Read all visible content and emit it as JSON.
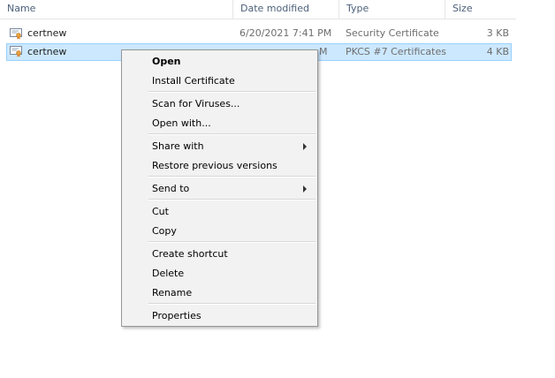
{
  "columns": {
    "name": "Name",
    "date_modified": "Date modified",
    "type": "Type",
    "size": "Size"
  },
  "files": [
    {
      "name": "certnew",
      "date": "6/20/2021 7:41 PM",
      "type": "Security Certificate",
      "size": "3 KB",
      "selected": false,
      "icon": "certificate-icon"
    },
    {
      "name": "certnew",
      "date": "M",
      "type": "PKCS #7 Certificates",
      "size": "4 KB",
      "selected": true,
      "icon": "certificate-icon"
    }
  ],
  "context_menu": {
    "open": "Open",
    "install_certificate": "Install Certificate",
    "scan_for_viruses": "Scan for Viruses...",
    "open_with": "Open with...",
    "share_with": "Share with",
    "restore_previous_versions": "Restore previous versions",
    "send_to": "Send to",
    "cut": "Cut",
    "copy": "Copy",
    "create_shortcut": "Create shortcut",
    "delete": "Delete",
    "rename": "Rename",
    "properties": "Properties"
  },
  "colors": {
    "selection_fill": "#cce8ff",
    "selection_border": "#99d1ff",
    "menu_background": "#f2f2f2",
    "header_text": "#4c607a"
  }
}
